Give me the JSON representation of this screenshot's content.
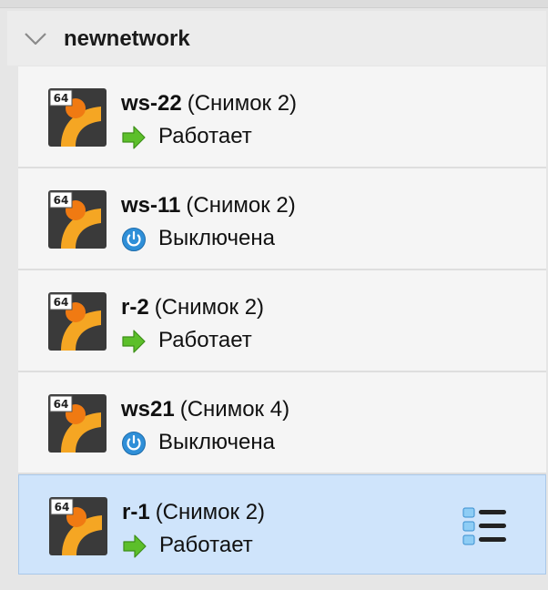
{
  "group": {
    "title": "newnetwork",
    "expanded_icon": "chevron-down-icon"
  },
  "vms": [
    {
      "name": "ws-22",
      "snapshot": "(Снимок 2)",
      "state": "Работает",
      "state_icon": "running-arrow-icon",
      "badge": "64",
      "selected": false
    },
    {
      "name": "ws-11",
      "snapshot": "(Снимок 2)",
      "state": "Выключена",
      "state_icon": "power-off-icon",
      "badge": "64",
      "selected": false
    },
    {
      "name": "r-2",
      "snapshot": "(Снимок 2)",
      "state": "Работает",
      "state_icon": "running-arrow-icon",
      "badge": "64",
      "selected": false
    },
    {
      "name": "ws21",
      "snapshot": "(Снимок 4)",
      "state": "Выключена",
      "state_icon": "power-off-icon",
      "badge": "64",
      "selected": false
    },
    {
      "name": "r-1",
      "snapshot": "(Снимок 2)",
      "state": "Работает",
      "state_icon": "running-arrow-icon",
      "badge": "64",
      "selected": true
    }
  ],
  "colors": {
    "selected_bg": "#cfe4fb",
    "running_green": "#5cbf2a",
    "power_blue": "#2f8fd8",
    "os_orange": "#f5a623"
  }
}
